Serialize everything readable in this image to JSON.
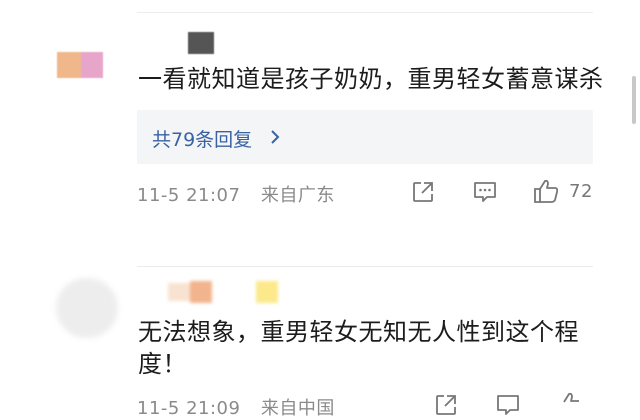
{
  "comments": [
    {
      "text": "一看就知道是孩子奶奶，重男轻女蓄意谋杀",
      "reply_summary": "共79条回复",
      "time": "11-5 21:07",
      "location": "来自广东",
      "like_count": "72"
    },
    {
      "text_line1": "无法想象，重男轻女无知无人性到这个程",
      "text_line2": "度！",
      "time": "11-5 21:09",
      "location": "来自中国"
    }
  ],
  "colors": {
    "reply_link": "#3a62a3",
    "meta_text": "#8a8a8a",
    "reply_bg": "#f4f5f7"
  },
  "icons": [
    "share-icon",
    "comment-icon",
    "like-icon",
    "chevron-right-icon"
  ]
}
